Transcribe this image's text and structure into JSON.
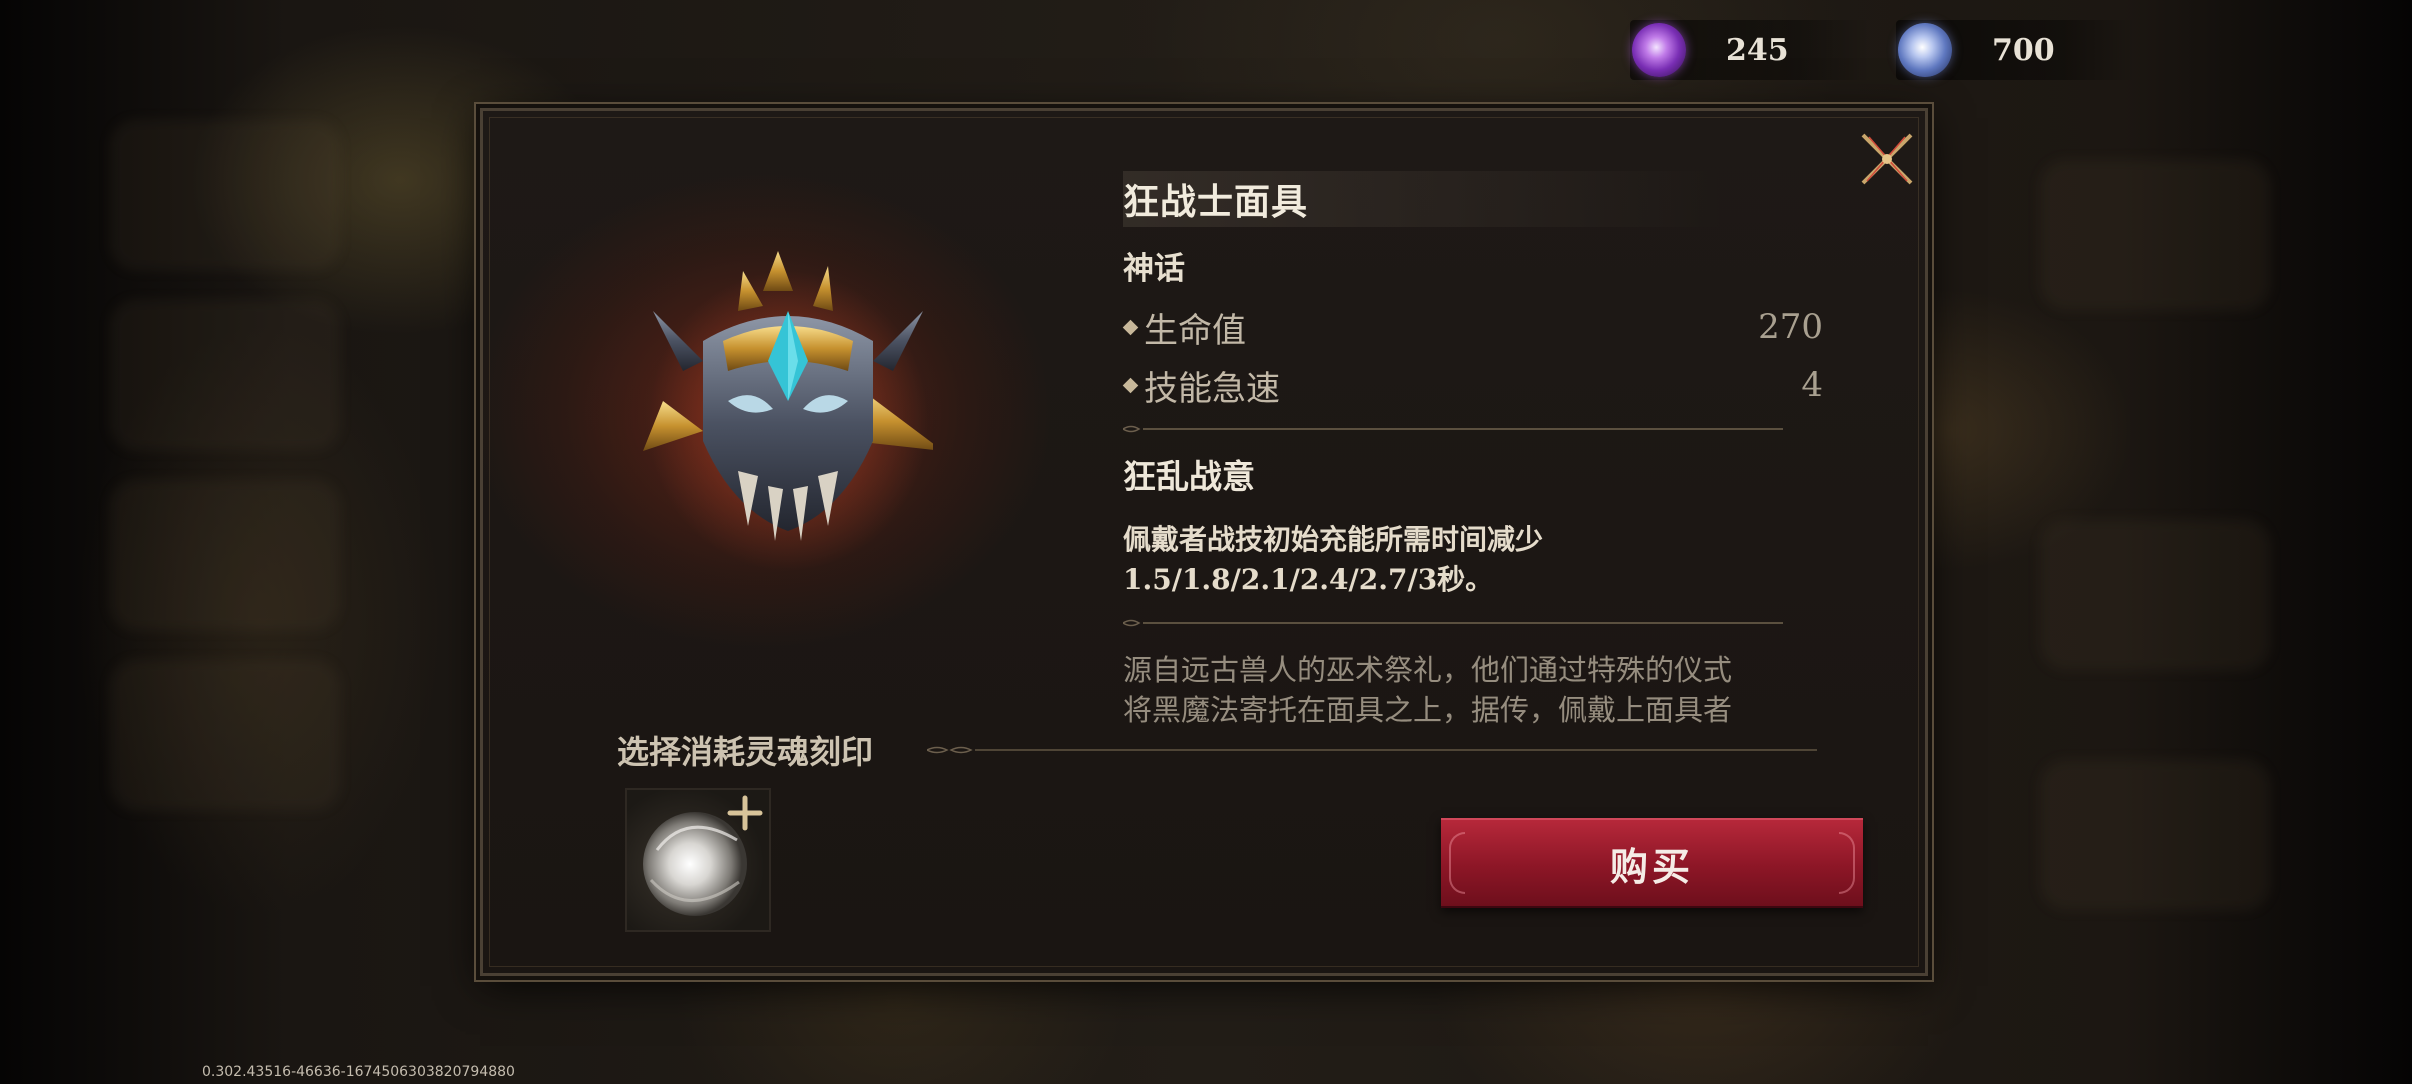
{
  "currencies": [
    {
      "icon": "purple-soul-crystal-icon",
      "value": "245",
      "color": "#9b4fd6"
    },
    {
      "icon": "blue-soul-orb-icon",
      "value": "700",
      "color": "#6e86d0"
    }
  ],
  "item": {
    "name": "狂战士面具",
    "rarity": "神话",
    "icon": "berserker-mask-icon",
    "stats": [
      {
        "name": "生命值",
        "value": "270"
      },
      {
        "name": "技能急速",
        "value": "4"
      }
    ],
    "skill": {
      "name": "狂乱战意",
      "description_line1": "佩戴者战技初始充能所需时间减少",
      "description_line2": "1.5/1.8/2.1/2.4/2.7/3秒。"
    },
    "lore_line1": "源自远古兽人的巫术祭礼，他们通过特殊的仪式",
    "lore_line2": "将黑魔法寄托在面具之上，据传，佩戴上面具者"
  },
  "soul_select": {
    "label": "选择消耗灵魂刻印",
    "slot_icon": "soul-imprint-orb-icon"
  },
  "buy_button": {
    "label": "购买",
    "color": "#a01f30"
  },
  "close_icon": "close-x-icon",
  "version_text": "0.302.43516-46636-1674506303820794880"
}
